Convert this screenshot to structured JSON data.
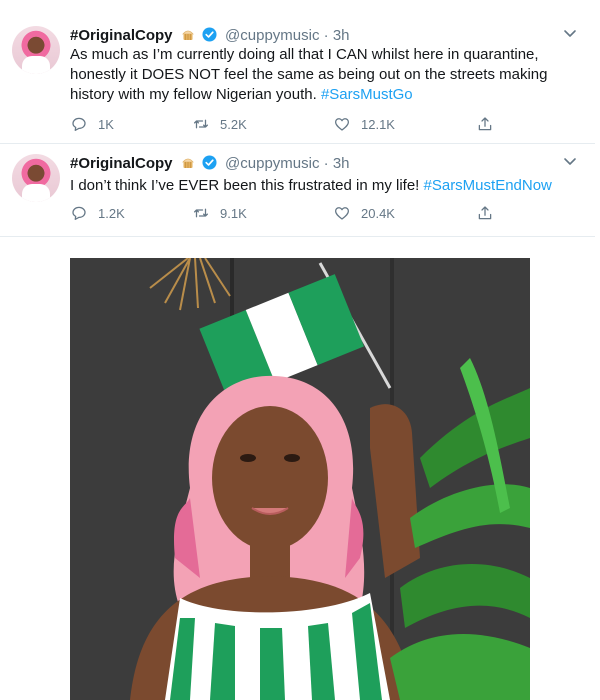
{
  "tweets": [
    {
      "display_name": "#OriginalCopy",
      "handle": "@cuppymusic",
      "time": "3h",
      "text_before": "As much as I’m currently doing all that I CAN whilst here in quarantine, honestly it DOES NOT feel the same as being out on the streets making history with my fellow Nigerian youth. ",
      "hashtag": "#SarsMustGo",
      "replies": "1K",
      "retweets": "5.2K",
      "likes": "12.1K"
    },
    {
      "display_name": "#OriginalCopy",
      "handle": "@cuppymusic",
      "time": "3h",
      "text_before": "I don’t think I’ve EVER been this frustrated in my life! ",
      "hashtag": "#SarsMustEndNow",
      "replies": "1.2K",
      "retweets": "9.1K",
      "likes": "20.4K"
    }
  ],
  "separator": " · ",
  "colors": {
    "accent": "#1da1f2",
    "muted": "#657786",
    "text": "#14171a",
    "flag_green": "#1e9f5b",
    "hair_pink": "#f3a2b5"
  },
  "icons": [
    "cupcake-emoji-icon",
    "verified-badge-icon",
    "chevron-down-icon",
    "reply-icon",
    "retweet-icon",
    "like-icon",
    "share-icon"
  ]
}
